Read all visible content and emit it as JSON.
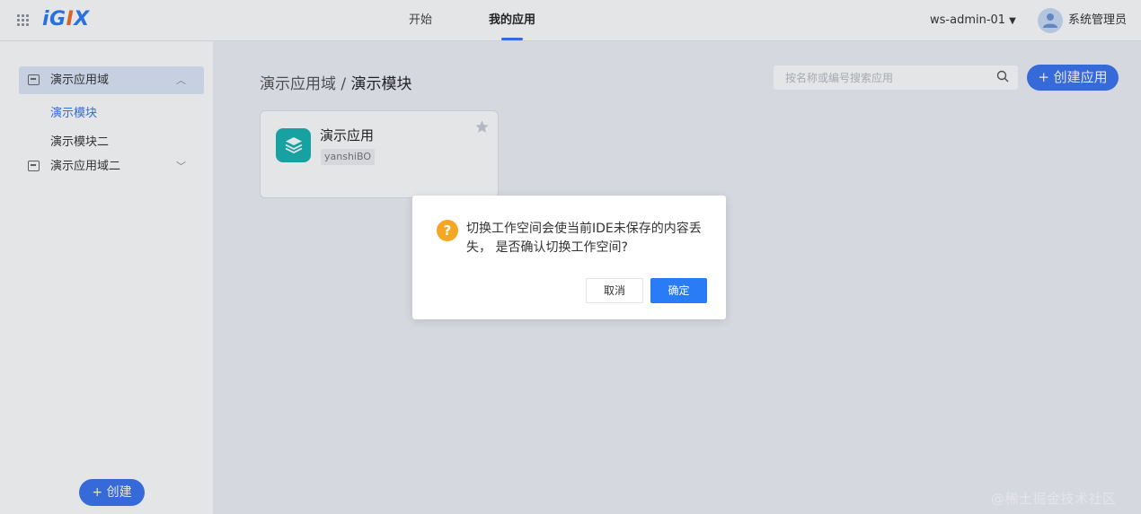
{
  "header": {
    "logo_parts": [
      "iG",
      "I",
      "X"
    ],
    "tabs": [
      {
        "label": "开始"
      },
      {
        "label": "我的应用",
        "active": true
      }
    ],
    "workspace": {
      "label": "ws-admin-01",
      "caret": "▼"
    },
    "user": {
      "name": "系统管理员",
      "avatar_icon": "user-avatar-icon"
    }
  },
  "sidebar": {
    "groups": [
      {
        "label": "演示应用域",
        "expanded": true,
        "chevron": "︿"
      },
      {
        "label": "演示应用域二",
        "expanded": false,
        "chevron": "﹀"
      }
    ],
    "items": [
      {
        "label": "演示模块",
        "active": true
      },
      {
        "label": "演示模块二",
        "active": false
      }
    ],
    "create_label": "+ 创建"
  },
  "main": {
    "breadcrumb": {
      "parent": "演示应用域 / ",
      "current": "演示模块"
    },
    "search": {
      "placeholder": "按名称或编号搜索应用"
    },
    "create_app_label": "+ 创建应用",
    "cards": [
      {
        "title": "演示应用",
        "tag": "yanshiBO",
        "icon": "layers-icon",
        "starred": false
      }
    ]
  },
  "dialog": {
    "icon": "question-icon",
    "icon_glyph": "?",
    "message": "切换工作空间会使当前IDE未保存的内容丢失， 是否确认切换工作空间?",
    "cancel_label": "取消",
    "ok_label": "确定"
  },
  "watermark": "@稀土掘金技术社区",
  "colors": {
    "accent": "#3a73f0",
    "logo_blue": "#2a7cf6",
    "logo_orange": "#f26b2b",
    "app_icon": "#16b3b0",
    "warning": "#f5a623"
  }
}
